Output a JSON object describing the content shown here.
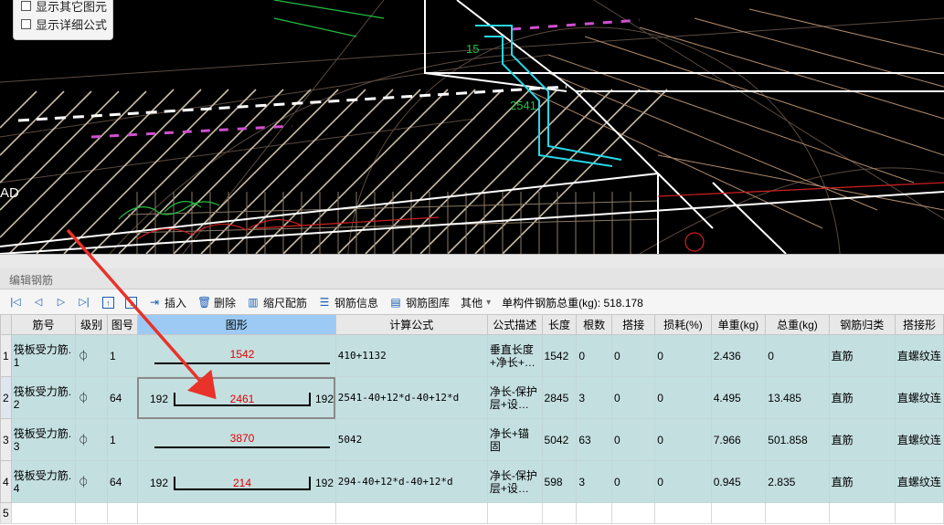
{
  "options": [
    "显示其它图元",
    "显示详细公式"
  ],
  "viewport": {
    "labels": [
      "15",
      "2541",
      "AD"
    ]
  },
  "panel": {
    "title": "编辑钢筋"
  },
  "toolbar": {
    "insert": "插入",
    "delete": "删除",
    "scale_rebar": "缩尺配筋",
    "rebar_info": "钢筋信息",
    "rebar_library": "钢筋图库",
    "other": "其他",
    "other_arrow": "▾",
    "total_weight": "单构件钢筋总重(kg): 518.178"
  },
  "table": {
    "headers": [
      "",
      "筋号",
      "级别",
      "图号",
      "图形",
      "计算公式",
      "公式描述",
      "长度",
      "根数",
      "搭接",
      "损耗(%)",
      "单重(kg)",
      "总重(kg)",
      "钢筋归类",
      "搭接形"
    ],
    "rows": [
      {
        "index": "1",
        "name": "筏板受力筋.1",
        "grade": "⏀",
        "shape_no": "1",
        "shape_mid": "1542",
        "shape_left": "",
        "shape_right": "",
        "formula": "410+1132",
        "desc": "垂直长度+净长+…",
        "length": "1542",
        "count": "0",
        "lap": "0",
        "loss": "0",
        "unit_weight": "2.436",
        "total_weight": "0",
        "category": "直筋",
        "lap_type": "直螺纹连"
      },
      {
        "index": "2",
        "name": "筏板受力筋.2",
        "grade": "⏀",
        "shape_no": "64",
        "shape_mid": "2461",
        "shape_left": "192",
        "shape_right": "192",
        "formula": "2541-40+12*d-40+12*d",
        "desc": "净长-保护层+设…",
        "length": "2845",
        "count": "3",
        "lap": "0",
        "loss": "0",
        "unit_weight": "4.495",
        "total_weight": "13.485",
        "category": "直筋",
        "lap_type": "直螺纹连"
      },
      {
        "index": "3",
        "name": "筏板受力筋.3",
        "grade": "⏀",
        "shape_no": "1",
        "shape_mid": "3870",
        "shape_left": "",
        "shape_right": "",
        "formula": "5042",
        "desc": "净长+锚固",
        "length": "5042",
        "count": "63",
        "lap": "0",
        "loss": "0",
        "unit_weight": "7.966",
        "total_weight": "501.858",
        "category": "直筋",
        "lap_type": "直螺纹连"
      },
      {
        "index": "4",
        "name": "筏板受力筋.4",
        "grade": "⏀",
        "shape_no": "64",
        "shape_mid": "214",
        "shape_left": "192",
        "shape_right": "192",
        "formula": "294-40+12*d-40+12*d",
        "desc": "净长-保护层+设…",
        "length": "598",
        "count": "3",
        "lap": "0",
        "loss": "0",
        "unit_weight": "0.945",
        "total_weight": "2.835",
        "category": "直筋",
        "lap_type": "直螺纹连"
      },
      {
        "index": "5",
        "empty": true
      }
    ]
  },
  "colors": {
    "row_bg": "#c4dfe0",
    "accent": "#1a5fb4",
    "dim_text": "#e00000",
    "arrow": "#e8322a"
  }
}
